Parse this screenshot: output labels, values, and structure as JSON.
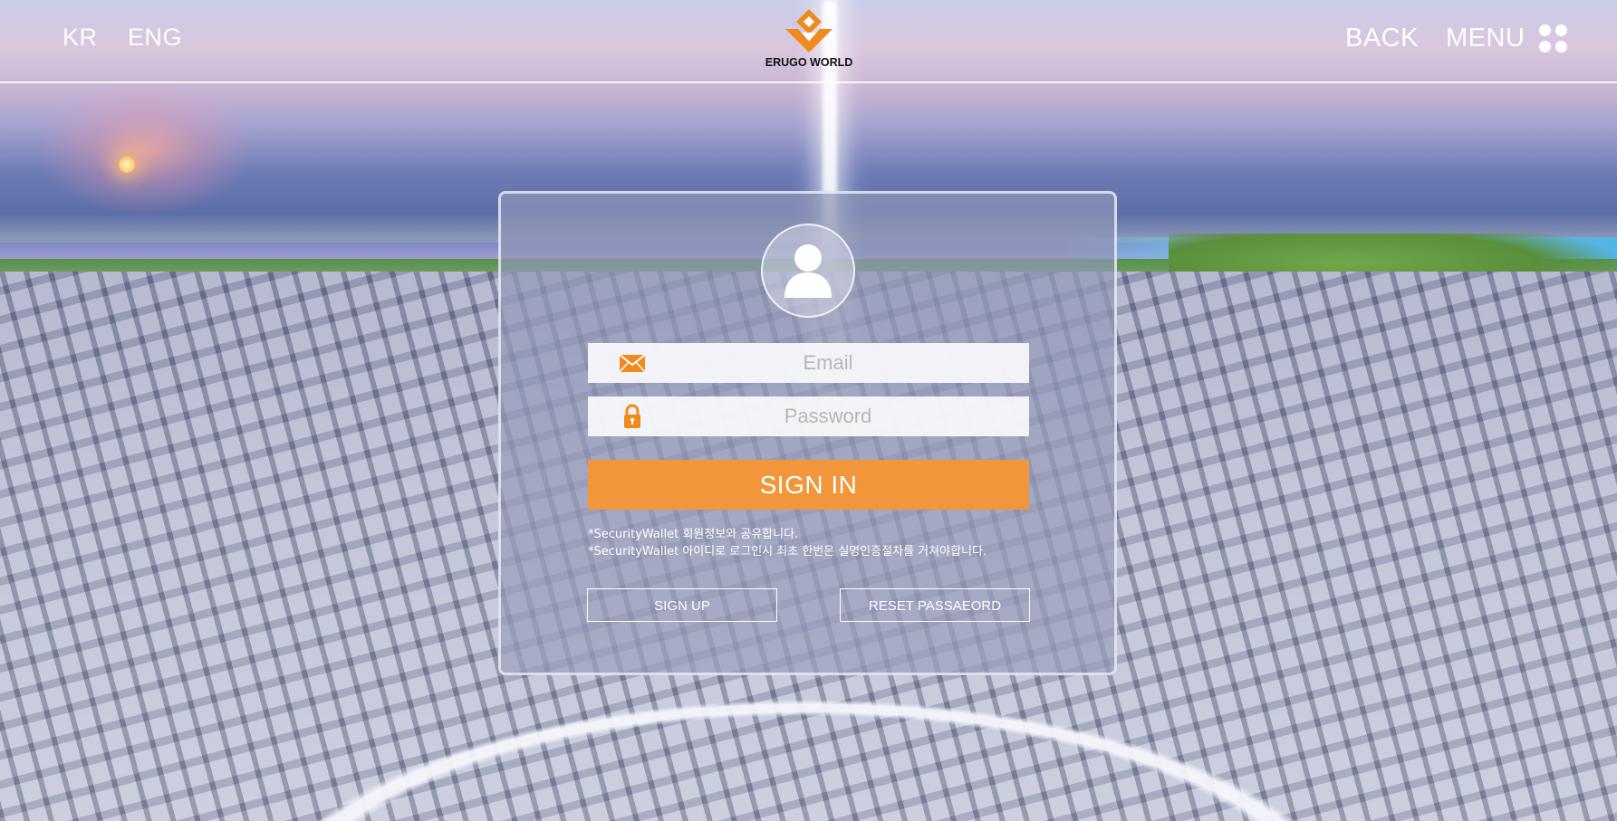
{
  "header": {
    "lang_kr": "KR",
    "lang_eng": "ENG",
    "logo_text": "ERUGO WORLD",
    "back_label": "BACK",
    "menu_label": "MENU"
  },
  "login": {
    "email_placeholder": "Email",
    "password_placeholder": "Password",
    "signin_label": "SIGN IN",
    "note_1": "*SecurityWallet 회원정보와 공유합니다.",
    "note_2": "*SecurityWallet 아이디로 로그인시 최초 한번은 실명인증절차를 거쳐야합니다.",
    "signup_label": "SIGN UP",
    "reset_label": "RESET PASSAEORD"
  },
  "colors": {
    "accent_orange": "#f1963b",
    "logo_orange": "#f08a1e"
  },
  "icons": [
    "erugo-logo-icon",
    "menu-grid-icon",
    "user-avatar-icon",
    "envelope-icon",
    "lock-icon"
  ]
}
